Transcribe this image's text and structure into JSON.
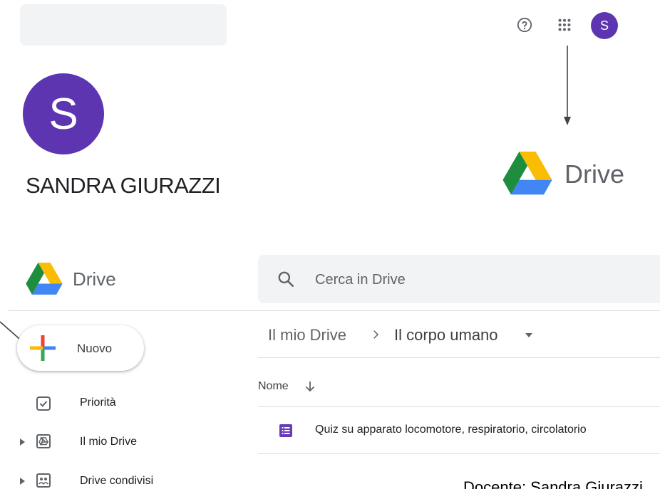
{
  "top": {
    "avatar_letter": "S"
  },
  "profile": {
    "avatar_letter": "S",
    "name": "SANDRA GIURAZZI"
  },
  "drive_logo": {
    "word": "Drive"
  },
  "app_header": {
    "drive_word": "Drive",
    "search_placeholder": "Cerca in Drive"
  },
  "new_button": {
    "label": "Nuovo"
  },
  "breadcrumb": {
    "root": "Il mio Drive",
    "current": "Il corpo umano"
  },
  "file_list": {
    "column_name": "Nome",
    "files": [
      {
        "name": "Quiz su apparato locomotore, respiratorio, circolatorio",
        "icon": "forms-icon"
      }
    ]
  },
  "sidebar": {
    "items": [
      {
        "label": "Priorità",
        "icon": "priority-icon"
      },
      {
        "label": "Il mio Drive",
        "icon": "my-drive-icon"
      },
      {
        "label": "Drive condivisi",
        "icon": "shared-drives-icon"
      }
    ]
  },
  "footer": {
    "text": "Docente: Sandra Giurazzi"
  },
  "colors": {
    "avatar": "#5e35b1",
    "drive_green": "#1e8e3e",
    "drive_yellow": "#fbbc04",
    "drive_blue": "#4285f4",
    "forms_purple": "#673ab7"
  }
}
